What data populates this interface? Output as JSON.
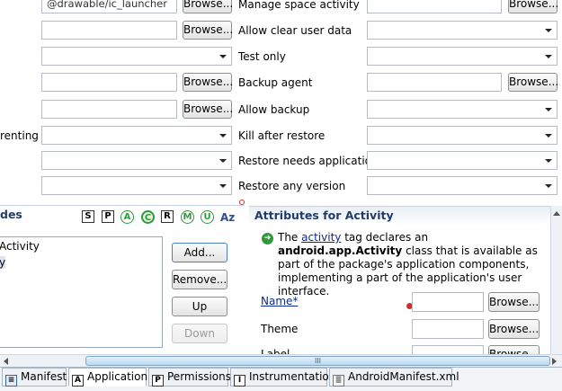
{
  "browse_label": "Browse...",
  "top": {
    "icon_field_value": "@drawable/ic_launcher",
    "left_partial_label": "renting",
    "right_labels": [
      "Manage space activity",
      "Allow clear user data",
      "Test only",
      "Backup agent",
      "Allow backup",
      "Kill after restore",
      "Restore needs application",
      "Restore any version"
    ]
  },
  "nodes": {
    "title": "des",
    "filter_icons": [
      "S",
      "P",
      "A",
      "C",
      "R",
      "M",
      "U",
      "Az"
    ],
    "tree_items": [
      "Activity",
      "y"
    ],
    "buttons": {
      "add": "Add...",
      "remove": "Remove...",
      "up": "Up",
      "down": "Down"
    }
  },
  "attributes": {
    "title": "Attributes for Activity",
    "desc_pre": "The ",
    "desc_link": "activity",
    "desc_mid": " tag declares an ",
    "desc_bold": "android.app.Activity",
    "desc_rest": "class that is available as part of the package's application components, implementing a part of the application's user interface.",
    "name_label": "Name*",
    "theme_label": "Theme",
    "label_label": "Label"
  },
  "scrollbar": {
    "grip": "III"
  },
  "tabs": [
    "Manifest",
    "Application",
    "Permissions",
    "Instrumentation",
    "AndroidManifest.xml"
  ],
  "tab_icons": [
    "",
    "A",
    "P",
    "I",
    ""
  ],
  "colors": {
    "section_title": "#1f3c6e",
    "link": "#0b2a8c",
    "info_icon": "#2e9a3a",
    "error_marker": "#d0302a"
  }
}
